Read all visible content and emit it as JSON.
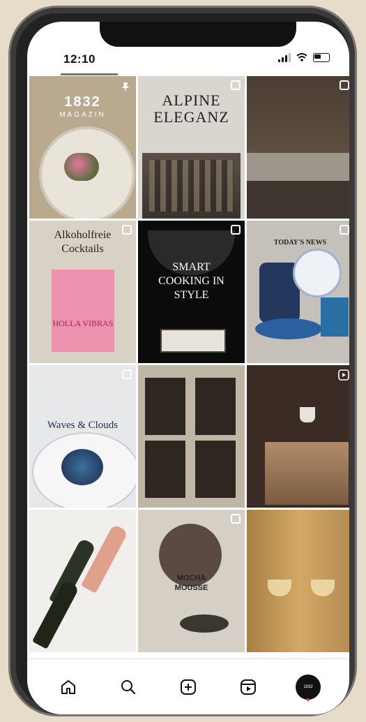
{
  "status": {
    "time": "12:10"
  },
  "grid": {
    "tiles": [
      {
        "title": "1832",
        "subtitle": "MAGAZIN"
      },
      {
        "title": "ALPINE",
        "title2": "ELEGANZ"
      },
      {
        "title": ""
      },
      {
        "title": "Alkoholfreie",
        "title2": "Cocktails",
        "book": "HOLLA VIBRAS"
      },
      {
        "title": "SMART",
        "title2": "COOKING IN",
        "title3": "STYLE"
      },
      {
        "title": "TODAY'S NEWS"
      },
      {
        "title": "Waves & Clouds"
      },
      {
        "title": ""
      },
      {
        "title": ""
      },
      {
        "title": ""
      },
      {
        "title": "MOCHA",
        "title2": "MOUSSE"
      },
      {
        "title": ""
      }
    ]
  },
  "tabbar": {
    "items": [
      "home",
      "search",
      "create",
      "reels",
      "profile"
    ],
    "profile_text": "1832"
  }
}
